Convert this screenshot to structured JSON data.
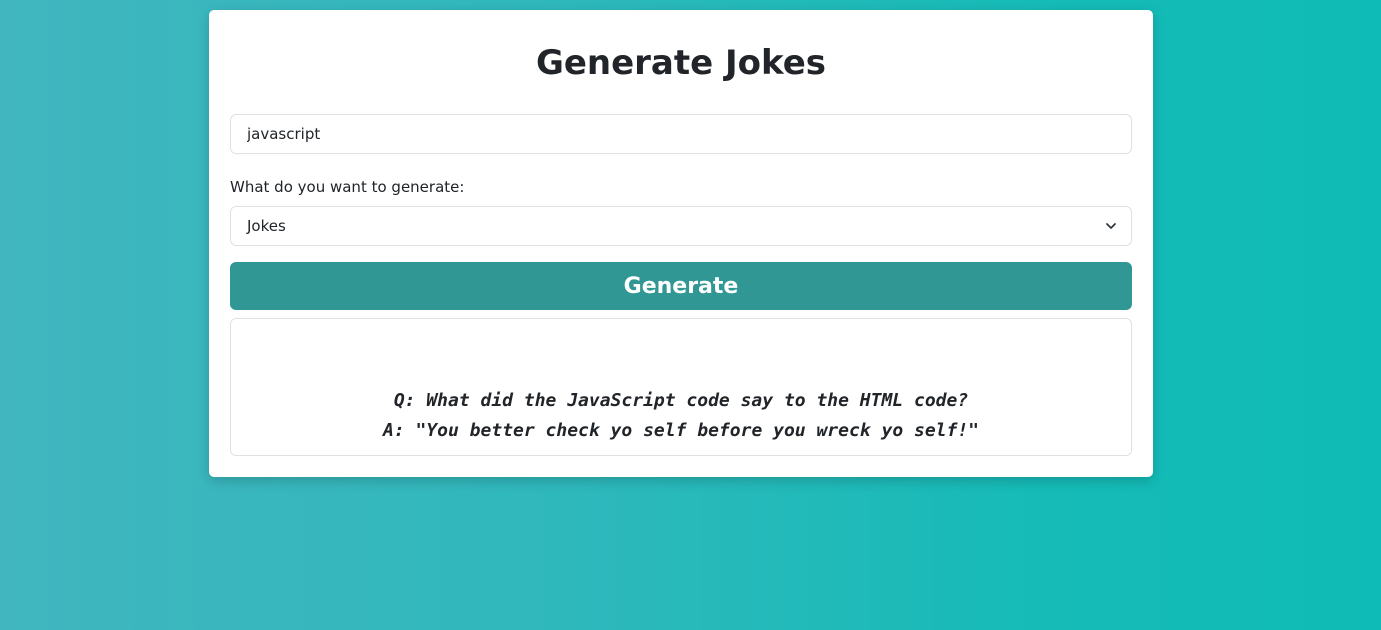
{
  "page": {
    "title": "Generate Jokes"
  },
  "form": {
    "topic_value": "javascript",
    "topic_placeholder": "",
    "select_label": "What do you want to generate:",
    "select_value": "Jokes",
    "button_label": "Generate"
  },
  "output": {
    "question": "Q: What did the JavaScript code say to the HTML code?",
    "answer": "A: \"You better check yo self before you wreck yo self!\""
  },
  "icons": {
    "select": "chevron-down-icon"
  },
  "colors": {
    "button": "#319794",
    "card": "#ffffff",
    "background_start": "#41b6bf",
    "background_end": "#0fbbb6"
  }
}
